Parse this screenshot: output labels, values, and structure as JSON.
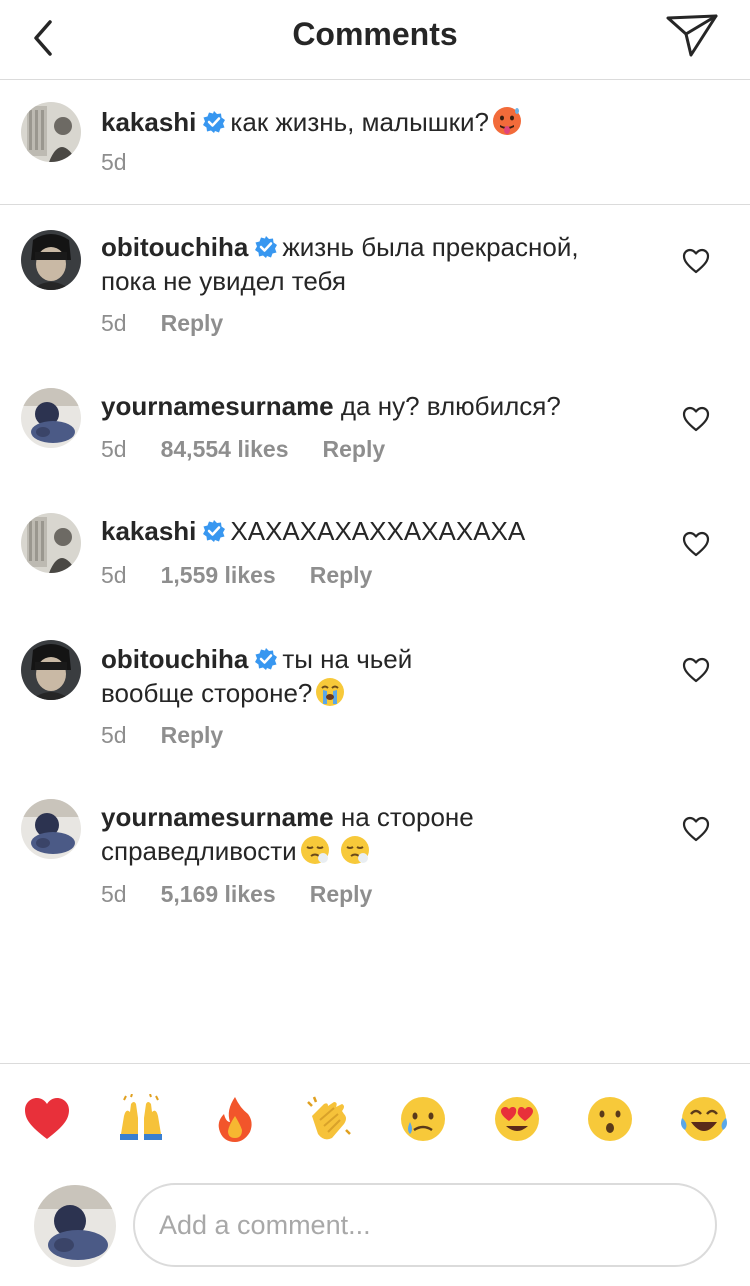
{
  "header": {
    "title": "Comments"
  },
  "caption": {
    "username": "kakashi",
    "text": "как жизнь, малышки?",
    "emoji": "hot-face",
    "time": "5d"
  },
  "comments": [
    {
      "username": "obitouchiha",
      "verified": true,
      "text_line1": "жизнь была прекрасной,",
      "text_line2": "пока не увидел тебя",
      "time": "5d",
      "likes": "",
      "reply": "Reply"
    },
    {
      "username": "yournamesurname",
      "verified": false,
      "text_line1": "да ну? влюбился?",
      "text_line2": "",
      "time": "5d",
      "likes": "84,554 likes",
      "reply": "Reply"
    },
    {
      "username": "kakashi",
      "verified": true,
      "text_line1": "ХАХАХАХАХХАХАХАХА",
      "text_line2": "",
      "time": "5d",
      "likes": "1,559 likes",
      "reply": "Reply"
    },
    {
      "username": "obitouchiha",
      "verified": true,
      "text_line1": "ты на чьей",
      "text_line2": "вообще стороне?",
      "emoji": "crying-face",
      "time": "5d",
      "likes": "",
      "reply": "Reply"
    },
    {
      "username": "yournamesurname",
      "verified": false,
      "text_line1": "на стороне",
      "text_line2": "справедливости",
      "emoji": "sad-relieved-face x2",
      "time": "5d",
      "likes": "5,169 likes",
      "reply": "Reply"
    }
  ],
  "quick_reactions": [
    "red-heart",
    "raising-hands",
    "fire",
    "clapping-hands",
    "crying-face",
    "heart-eyes",
    "astonished-face",
    "tears-of-joy"
  ],
  "composer": {
    "placeholder": "Add a comment..."
  },
  "colors": {
    "text": "#262626",
    "muted": "#8e8e8e",
    "border": "#dbdbdb",
    "verified": "#3897f0"
  }
}
